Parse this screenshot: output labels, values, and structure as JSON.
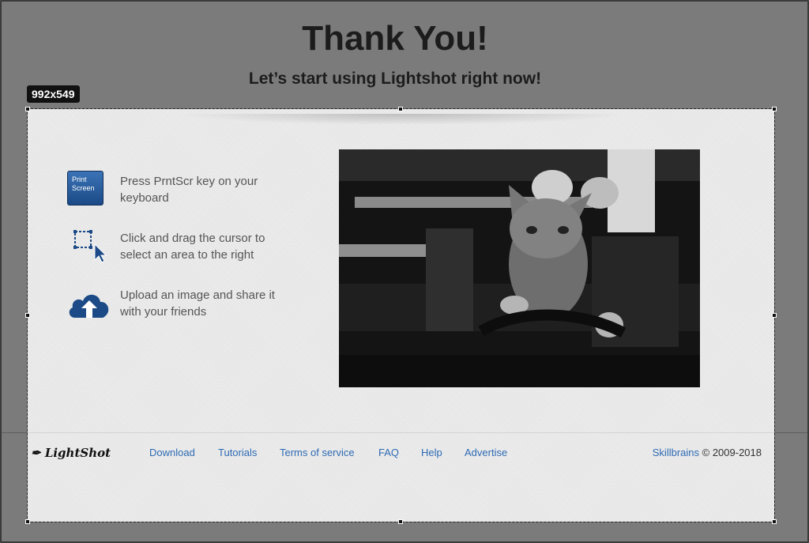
{
  "page": {
    "title": "Thank You!",
    "subtitle": "Let’s start using Lightshot right now!"
  },
  "selection": {
    "size_label": "992x549"
  },
  "steps": [
    {
      "icon": "print-screen-key-icon",
      "key_label_line1": "Print",
      "key_label_line2": "Screen",
      "text": "Press PrntScr key on your keyboard"
    },
    {
      "icon": "select-area-cursor-icon",
      "text": "Click and drag the cursor to select an area to the right"
    },
    {
      "icon": "cloud-upload-icon",
      "text": "Upload an image and share it with your friends"
    }
  ],
  "photo": {
    "description_icon": "cat-photo"
  },
  "footer": {
    "logo": "LightShot",
    "links": [
      "Download",
      "Tutorials",
      "Terms of service",
      "FAQ",
      "Help",
      "Advertise"
    ],
    "company": "Skillbrains",
    "copyright": "© 2009-2018"
  },
  "colors": {
    "link": "#2e6bb4",
    "accent": "#1b4a86",
    "dim_background": "#7b7b7b"
  }
}
